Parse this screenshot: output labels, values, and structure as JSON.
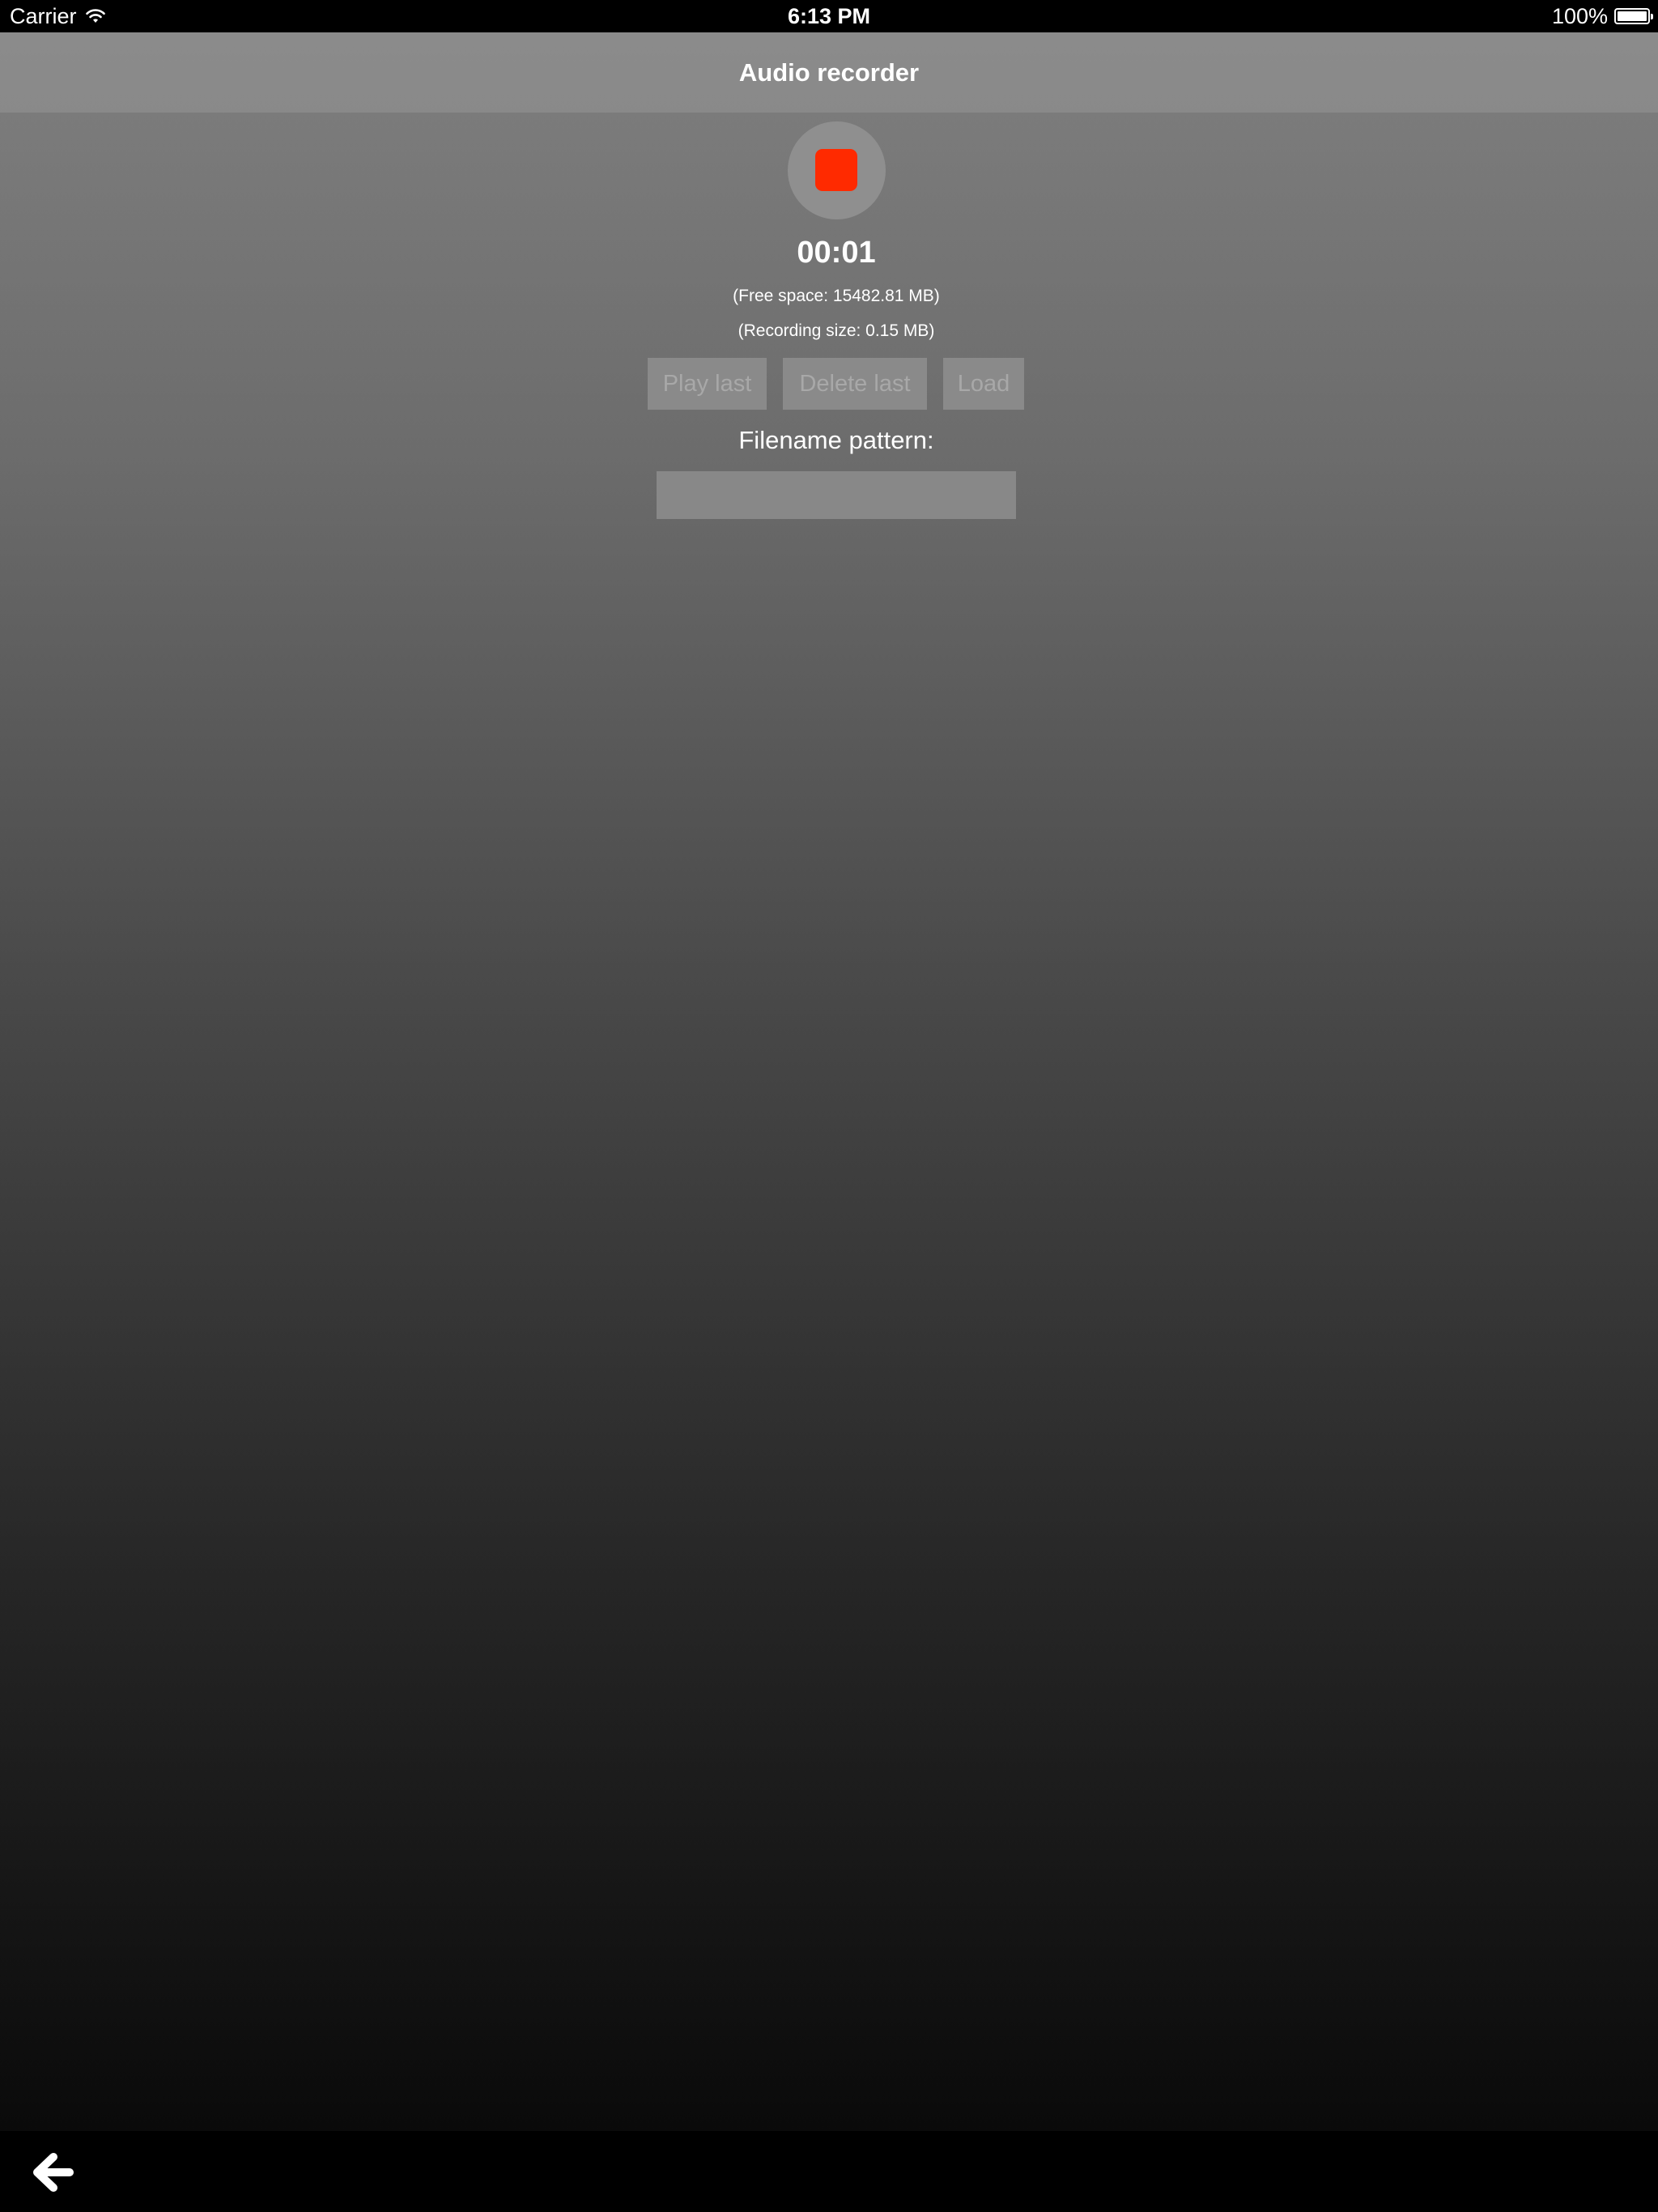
{
  "status_bar": {
    "carrier": "Carrier",
    "time": "6:13 PM",
    "battery": "100%",
    "icons": [
      "wifi-icon",
      "battery-icon"
    ],
    "battery_level": 1.0
  },
  "nav": {
    "title": "Audio recorder"
  },
  "recorder": {
    "state_icon": "stop-icon",
    "stop_color": "#ff2a00",
    "timer": "00:01",
    "free_space": "(Free space: 15482.81 MB)",
    "recording_size": "(Recording size: 0.15 MB)"
  },
  "actions": {
    "play_last": "Play last",
    "delete_last": "Delete last",
    "load": "Load"
  },
  "filename": {
    "label": "Filename pattern:",
    "value": "",
    "placeholder": ""
  },
  "bottom_bar": {
    "back_icon": "back-arrow-icon"
  }
}
